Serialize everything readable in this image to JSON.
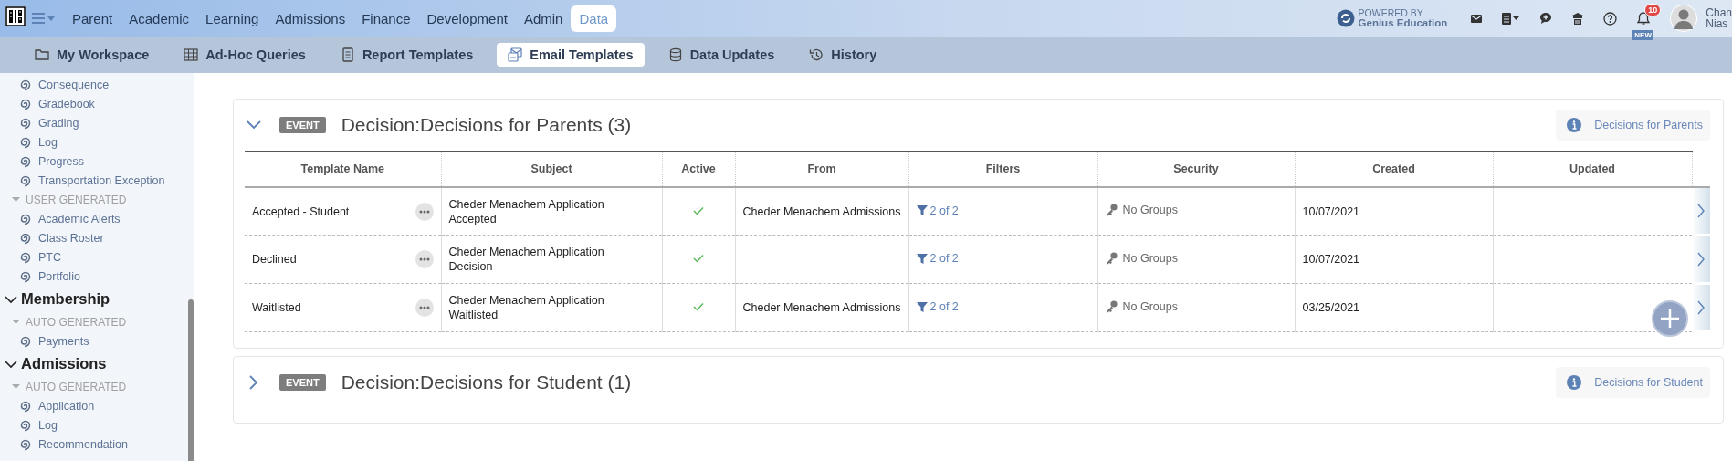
{
  "topbar": {
    "menu_items": [
      {
        "label": "Parent",
        "selected": false
      },
      {
        "label": "Academic",
        "selected": false
      },
      {
        "label": "Learning",
        "selected": false
      },
      {
        "label": "Admissions",
        "selected": false
      },
      {
        "label": "Finance",
        "selected": false
      },
      {
        "label": "Development",
        "selected": false
      },
      {
        "label": "Admin",
        "selected": false
      },
      {
        "label": "Data",
        "selected": true
      }
    ],
    "powered_by": {
      "line_1": "POWERED BY",
      "line_2": "Genius Education"
    },
    "notifications": {
      "count": "10",
      "tag": "NEW"
    },
    "user": {
      "line_1": "Chan",
      "line_2": "Nias"
    }
  },
  "subnav": {
    "tabs": [
      {
        "label": "My Workspace",
        "selected": false
      },
      {
        "label": "Ad-Hoc Queries",
        "selected": false
      },
      {
        "label": "Report Templates",
        "selected": false
      },
      {
        "label": "Email Templates",
        "selected": true
      },
      {
        "label": "Data Updates",
        "selected": false
      },
      {
        "label": "History",
        "selected": false
      }
    ]
  },
  "sidebar": {
    "sections": [
      {
        "groups": [
          {
            "items": [
              "Consequence",
              "Gradebook",
              "Grading",
              "Log",
              "Progress",
              "Transportation Exception"
            ]
          },
          {
            "label": "USER GENERATED",
            "expanded": true,
            "items": [
              "Academic Alerts",
              "Class Roster",
              "PTC",
              "Portfolio"
            ]
          }
        ]
      },
      {
        "title": "Membership",
        "expanded": true,
        "groups": [
          {
            "label": "AUTO GENERATED",
            "expanded": true,
            "items": [
              "Payments"
            ]
          }
        ]
      },
      {
        "title": "Admissions",
        "expanded": true,
        "groups": [
          {
            "label": "AUTO GENERATED",
            "expanded": true,
            "items": [
              "Application",
              "Log",
              "Recommendation"
            ]
          }
        ]
      }
    ]
  },
  "templates": [
    {
      "badge": "EVENT",
      "title": "Decision:Decisions for Parents (3)",
      "expanded": true,
      "info": "Decisions for Parents",
      "columns": [
        "Template Name",
        "Subject",
        "Active",
        "From",
        "Filters",
        "Security",
        "Created",
        "Updated"
      ],
      "rows": [
        {
          "name": "Accepted - Student",
          "subject": "Cheder Menachem Application Accepted",
          "active": true,
          "from": "Cheder Menachem Admissions",
          "filters": "2 of 2",
          "security": "No Groups",
          "created": "10/07/2021"
        },
        {
          "name": "Declined",
          "subject": "Cheder Menachem Application Decision",
          "active": true,
          "filters": "2 of 2",
          "security": "No Groups",
          "created": "10/07/2021"
        },
        {
          "name": "Waitlisted",
          "subject": "Cheder Menachem Application Waitlisted",
          "active": true,
          "from": "Cheder Menachem Admissions",
          "filters": "2 of 2",
          "security": "No Groups",
          "created": "03/25/2021"
        }
      ]
    },
    {
      "badge": "EVENT",
      "title": "Decision:Decisions for Student (1)",
      "expanded": false,
      "info": "Decisions for Student"
    }
  ]
}
